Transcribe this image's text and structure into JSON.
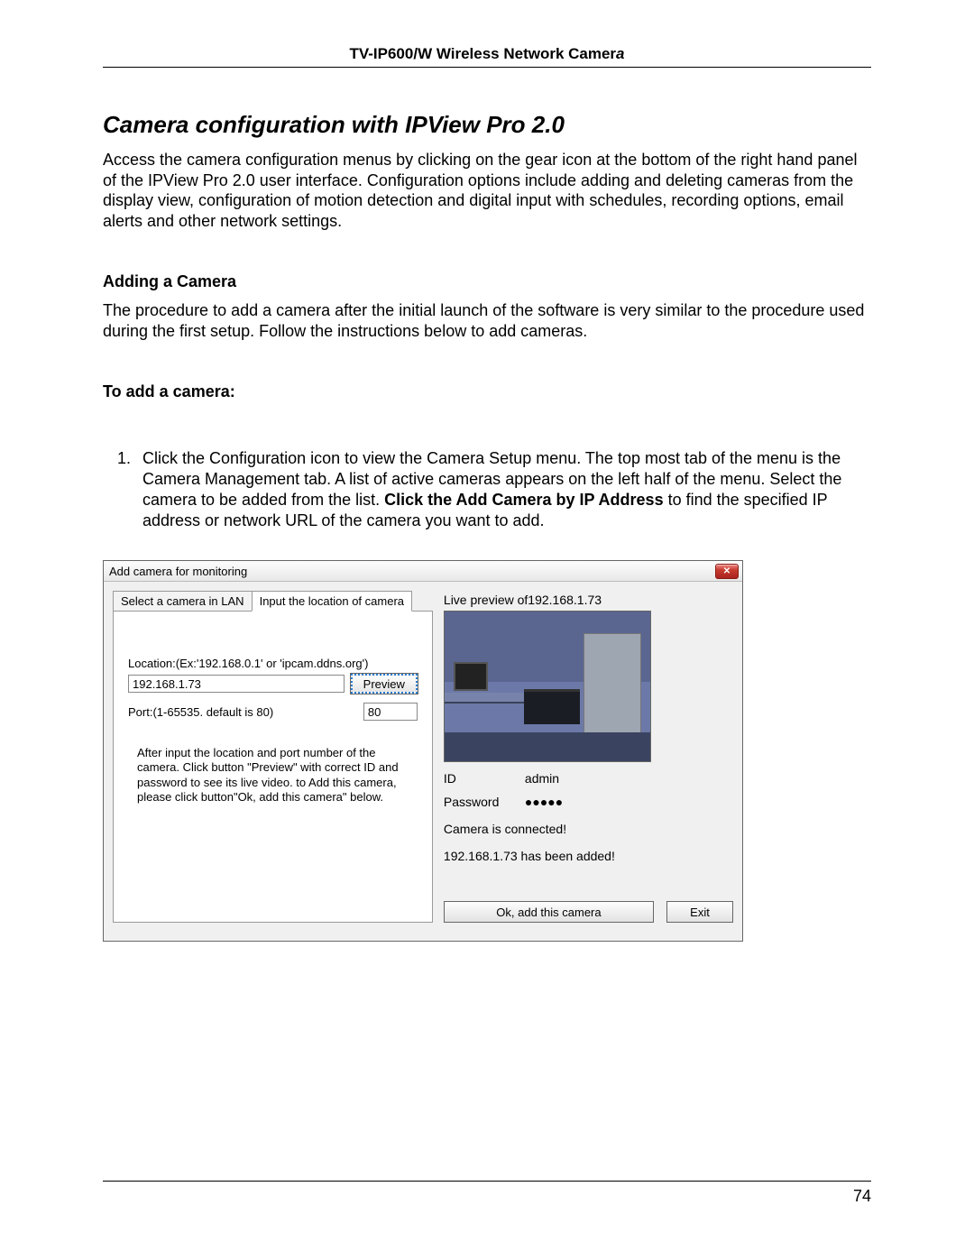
{
  "header": {
    "product_bold": "TV-IP600/W Wireless Network Camer",
    "product_ital": "a"
  },
  "section_title": "Camera configuration with IPView Pro 2.0",
  "intro": "Access the camera configuration menus by clicking on the gear icon at the bottom of the right hand panel of the IPView Pro 2.0 user interface. Configuration options include adding and deleting cameras from the display view, configuration of motion detection and digital input with schedules, recording options, email alerts and other network settings.",
  "sub1": "Adding a Camera",
  "sub1_body": "The procedure to add a camera after the initial launch of the software is very similar to the procedure used during the first setup. Follow the instructions below to add cameras.",
  "sub2": "To add a camera:",
  "step1_pre": "Click the Configuration icon to view the Camera Setup menu. The top most tab of the menu is the Camera Management tab. A list of active cameras appears on the left half of the menu. Select the camera to be added from the list. ",
  "step1_bold": "Click the Add Camera by IP Address",
  "step1_post": " to find the specified IP address or network URL of the camera you want to add.",
  "dialog": {
    "title": "Add camera for monitoring",
    "tab_lan": "Select a camera in LAN",
    "tab_loc": "Input the location of camera",
    "location_label": "Location:(Ex:'192.168.0.1' or 'ipcam.ddns.org')",
    "location_value": "192.168.1.73",
    "preview_btn": "Preview",
    "port_label": "Port:(1-65535. default is 80)",
    "port_value": "80",
    "hint": "After input the location and port number of the camera. Click button \"Preview\" with correct ID and password to see its live video. to Add this camera, please click button\"Ok, add this camera\" below.",
    "preview_title": "Live preview of192.168.1.73",
    "id_label": "ID",
    "id_value": "admin",
    "pwd_label": "Password",
    "pwd_value": "●●●●●",
    "status_connected": "Camera is connected!",
    "status_added": "192.168.1.73 has been added!",
    "ok_btn": "Ok, add this camera",
    "exit_btn": "Exit"
  },
  "page_number": "74"
}
